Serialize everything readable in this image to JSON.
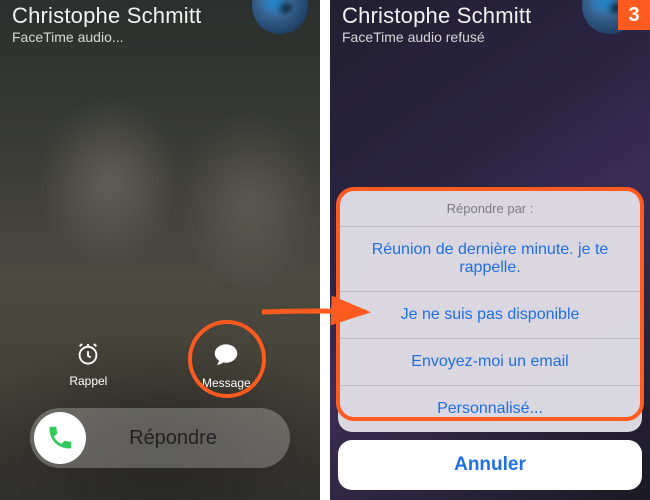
{
  "step_number": "3",
  "left_screen": {
    "caller_name": "Christophe Schmitt",
    "subline": "FaceTime audio...",
    "rappel_label": "Rappel",
    "message_label": "Message",
    "answer_label": "Répondre"
  },
  "right_screen": {
    "caller_name": "Christophe Schmitt",
    "subline": "FaceTime audio refusé",
    "sheet_title": "Répondre par :",
    "sheet_items": [
      "Réunion de dernière minute. je te rappelle.",
      "Je ne suis pas disponible",
      "Envoyez-moi un email",
      "Personnalisé..."
    ],
    "cancel_label": "Annuler"
  }
}
